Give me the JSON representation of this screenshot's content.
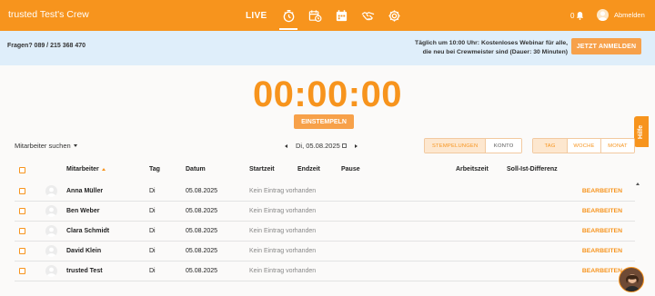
{
  "app": {
    "title": "trusted Test's Crew"
  },
  "nav": {
    "live_label": "LIVE",
    "icons": [
      "stopwatch-icon",
      "calendar-clock-icon",
      "calendar-icon",
      "handshake-icon",
      "gear-icon"
    ],
    "notification_count": "0",
    "logout_label": "Abmelden"
  },
  "infobar": {
    "phone": "Fragen? 089 / 215 368 470",
    "webinar_line1": "Täglich um 10:00 Uhr: Kostenloses Webinar für alle,",
    "webinar_line2": "die neu bei Crewmeister sind (Dauer: 30 Minuten)",
    "register_label": "JETZT ANMELDEN"
  },
  "timer": {
    "value": "00:00:00",
    "clockin_label": "EINSTEMPELN"
  },
  "filters": {
    "employee_search": "Mitarbeiter suchen",
    "date": "Di, 05.08.2025",
    "view_toggle": [
      "STEMPELUNGEN",
      "KONTO"
    ],
    "period_toggle": [
      "TAG",
      "WOCHE",
      "MONAT"
    ]
  },
  "table": {
    "headers": {
      "employee": "Mitarbeiter",
      "day": "Tag",
      "date": "Datum",
      "start": "Startzeit",
      "end": "Endzeit",
      "pause": "Pause",
      "worktime": "Arbeitszeit",
      "diff": "Soll-Ist-Differenz"
    },
    "rows": [
      {
        "name": "Anna Müller",
        "day": "Di",
        "date": "05.08.2025",
        "status": "Kein Eintrag vorhanden",
        "action": "BEARBEITEN"
      },
      {
        "name": "Ben Weber",
        "day": "Di",
        "date": "05.08.2025",
        "status": "Kein Eintrag vorhanden",
        "action": "BEARBEITEN"
      },
      {
        "name": "Clara Schmidt",
        "day": "Di",
        "date": "05.08.2025",
        "status": "Kein Eintrag vorhanden",
        "action": "BEARBEITEN"
      },
      {
        "name": "David Klein",
        "day": "Di",
        "date": "05.08.2025",
        "status": "Kein Eintrag vorhanden",
        "action": "BEARBEITEN"
      },
      {
        "name": "trusted Test",
        "day": "Di",
        "date": "05.08.2025",
        "status": "Kein Eintrag vorhanden",
        "action": "BEARBEITEN"
      }
    ]
  },
  "help": {
    "label": "Hilfe"
  },
  "colors": {
    "brand": "#f7941d",
    "info_bg": "#dfeefa",
    "page_bg": "#fbfaf9"
  }
}
